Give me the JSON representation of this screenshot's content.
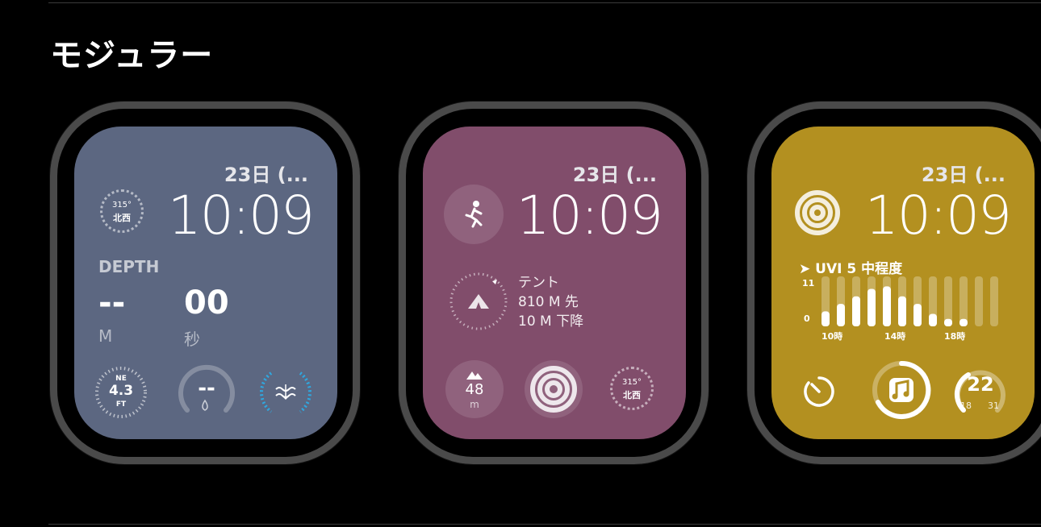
{
  "section": {
    "title": "モジュラー"
  },
  "watches": [
    {
      "date": "23日 (...",
      "time": "10:09",
      "compass": {
        "degrees": "315°",
        "direction": "北西"
      },
      "depth": {
        "label": "DEPTH",
        "value": "--",
        "unit": "M",
        "seconds_value": "00",
        "seconds_unit": "秒"
      },
      "bottom": {
        "depth_gauge": {
          "heading": "NE",
          "value": "4.3",
          "unit": "FT"
        },
        "water_temp": {
          "value": "--"
        },
        "tide_icon": "water-waves-icon"
      },
      "color": "#5c6781"
    },
    {
      "date": "23日 (...",
      "time": "10:09",
      "activity_icon": "running-figure-icon",
      "waypoint": {
        "name": "テント",
        "distance": "810 M 先",
        "elevation": "10 M 下降"
      },
      "bottom": {
        "elevation": {
          "value": "48",
          "unit": "m"
        },
        "compass": {
          "degrees": "315°",
          "direction": "北西"
        }
      },
      "color": "#814d6b"
    },
    {
      "date": "23日 (...",
      "time": "10:09",
      "uv": {
        "label": "UVI 5",
        "level": "中程度",
        "axis_max": "11",
        "axis_min": "0",
        "times": [
          "10時",
          "14時",
          "18時"
        ],
        "bars": [
          0.3,
          0.45,
          0.6,
          0.75,
          0.8,
          0.6,
          0.45,
          0.25,
          0.15,
          0.15,
          0.0,
          0.0
        ]
      },
      "bottom": {
        "timer_icon": "timer-icon",
        "music_icon": "music-note-icon",
        "temperature": {
          "value": "22",
          "low": "18",
          "high": "31"
        }
      },
      "color": "#b39020"
    }
  ]
}
